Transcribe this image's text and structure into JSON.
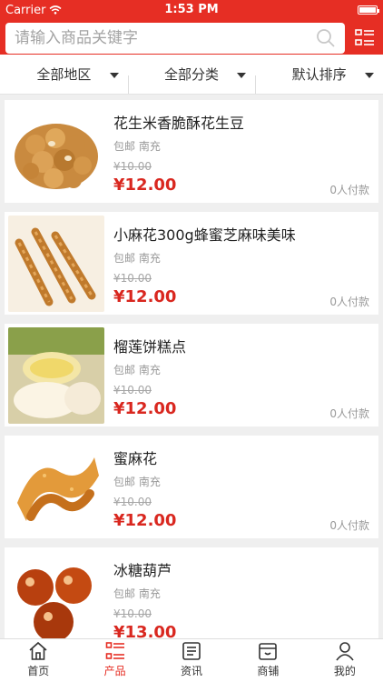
{
  "status": {
    "carrier": "Carrier",
    "time": "1:53 PM"
  },
  "search": {
    "placeholder": "请输入商品关键字"
  },
  "filters": [
    {
      "label": "全部地区"
    },
    {
      "label": "全部分类"
    },
    {
      "label": "默认排序"
    }
  ],
  "products": [
    {
      "title": "花生米香脆酥花生豆",
      "meta": "包邮  南充",
      "old_price": "¥10.00",
      "price": "¥12.00",
      "sold": "0人付款"
    },
    {
      "title": "小麻花300g蜂蜜芝麻味美味",
      "meta": "包邮  南充",
      "old_price": "¥10.00",
      "price": "¥12.00",
      "sold": "0人付款"
    },
    {
      "title": "榴莲饼糕点",
      "meta": "包邮  南充",
      "old_price": "¥10.00",
      "price": "¥12.00",
      "sold": "0人付款"
    },
    {
      "title": "蜜麻花",
      "meta": "包邮  南充",
      "old_price": "¥10.00",
      "price": "¥12.00",
      "sold": "0人付款"
    },
    {
      "title": "冰糖葫芦",
      "meta": "包邮  南充",
      "old_price": "¥10.00",
      "price": "¥13.00",
      "sold": ""
    }
  ],
  "tabs": [
    {
      "label": "首页",
      "icon": "home-icon"
    },
    {
      "label": "产品",
      "icon": "product-list-icon"
    },
    {
      "label": "资讯",
      "icon": "news-icon"
    },
    {
      "label": "商铺",
      "icon": "shop-icon"
    },
    {
      "label": "我的",
      "icon": "profile-icon"
    }
  ],
  "colors": {
    "brand": "#e62e24",
    "price": "#d9271f"
  }
}
